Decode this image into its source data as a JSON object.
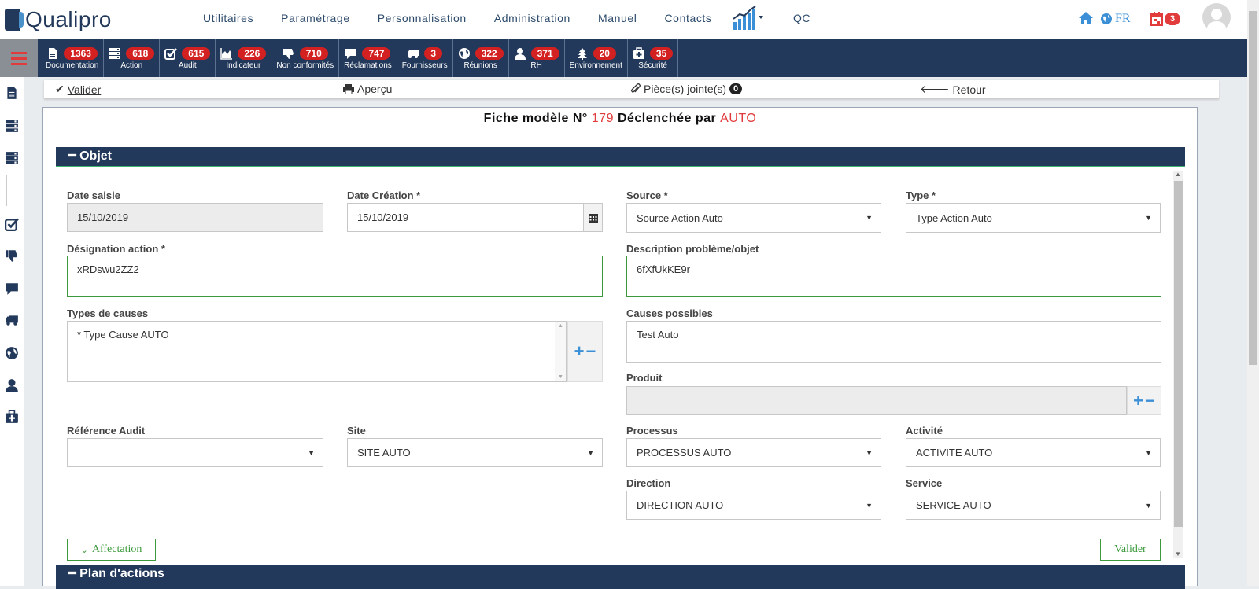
{
  "brand": {
    "logo_text": "Qualipro"
  },
  "menu": [
    "Utilitaires",
    "Paramétrage",
    "Personnalisation",
    "Administration",
    "Manuel",
    "Contacts"
  ],
  "qc_label": "QC",
  "lang": "FR",
  "notif_count": "3",
  "modules": [
    {
      "label": "Documentation",
      "count": "1363",
      "icon": "document-icon"
    },
    {
      "label": "Action",
      "count": "618",
      "icon": "server-icon"
    },
    {
      "label": "Audit",
      "count": "615",
      "icon": "checkbox-icon"
    },
    {
      "label": "Indicateur",
      "count": "226",
      "icon": "area-chart-icon"
    },
    {
      "label": "Non conformités",
      "count": "710",
      "icon": "thumbs-down-icon"
    },
    {
      "label": "Réclamations",
      "count": "747",
      "icon": "comment-icon"
    },
    {
      "label": "Fournisseurs",
      "count": "3",
      "icon": "truck-icon"
    },
    {
      "label": "Réunions",
      "count": "322",
      "icon": "globe-meeting-icon"
    },
    {
      "label": "RH",
      "count": "371",
      "icon": "user-icon"
    },
    {
      "label": "Environnement",
      "count": "20",
      "icon": "tree-icon"
    },
    {
      "label": "Sécurité",
      "count": "35",
      "icon": "medkit-icon"
    }
  ],
  "actions": {
    "valider": "Valider",
    "apercu": "Aperçu",
    "pieces": "Pièce(s) jointe(s)",
    "pieces_count": "0",
    "retour": "Retour"
  },
  "fiche": {
    "prefix": "Fiche modèle N°",
    "number": "179",
    "middle": "Déclenchée par",
    "by": "AUTO"
  },
  "section_objet": "Objet",
  "section_plan": "Plan d'actions",
  "form": {
    "date_saisie_label": "Date saisie",
    "date_saisie": "15/10/2019",
    "date_creation_label": "Date Création *",
    "date_creation": "15/10/2019",
    "source_label": "Source *",
    "source": "Source Action Auto",
    "type_label": "Type *",
    "type": "Type Action Auto",
    "designation_label": "Désignation action *",
    "designation": "xRDswu2ZZ2",
    "description_label": "Description problème/objet",
    "description": "6fXfUkKE9r",
    "types_causes_label": "Types de causes",
    "types_causes": "* Type Cause AUTO",
    "causes_possibles_label": "Causes possibles",
    "causes_possibles": "Test Auto",
    "produit_label": "Produit",
    "produit": "",
    "ref_audit_label": "Référence Audit",
    "ref_audit": "",
    "site_label": "Site",
    "site": "SITE AUTO",
    "processus_label": "Processus",
    "processus": "PROCESSUS AUTO",
    "activite_label": "Activité",
    "activite": "ACTIVITE AUTO",
    "direction_label": "Direction",
    "direction": "DIRECTION AUTO",
    "service_label": "Service",
    "service": "SERVICE AUTO"
  },
  "buttons": {
    "affectation": "Affectation",
    "valider": "Valider"
  },
  "colors": {
    "navy": "#23395b",
    "badge_red": "#d32020",
    "accent_blue": "#3a8fd6",
    "green": "#3c9a3c"
  }
}
